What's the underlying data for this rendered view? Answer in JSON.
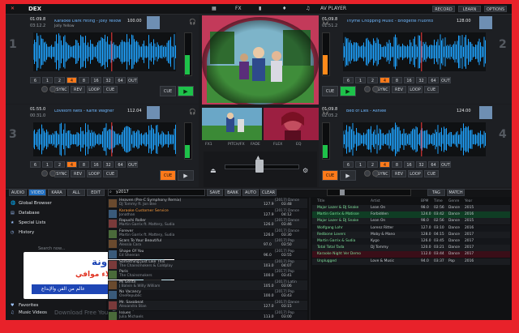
{
  "app": {
    "logo": "DEX",
    "colors": {
      "accent": "#1fa3ff",
      "green": "#22c14a",
      "orange": "#ff7a1a",
      "red": "#e8222a",
      "frame": "#e8222a"
    }
  },
  "topbar": {
    "left_items": [
      "▦",
      "FX",
      "▮",
      "♦",
      "♫"
    ],
    "right_items": [
      "RECORD",
      "LEARN",
      "OPTIONS"
    ],
    "right_title": "AV PLAYER"
  },
  "decks": [
    {
      "num": "1",
      "time": "01:09.8",
      "remain": "03:12.2",
      "title": "Karaoke Dark Hiting - Jolly Yellow",
      "sub": "Jolly Yellow",
      "bpm": "100.00",
      "side": "left",
      "color": "#1fa3ff",
      "pitch_row": [
        "6",
        "1",
        "2",
        "4",
        "8",
        "16",
        "32",
        "64",
        "OUT"
      ],
      "loop_row": [
        "SYNC",
        "REV",
        "LOOP",
        "CUE"
      ],
      "play": "▶",
      "cue": "CUE"
    },
    {
      "num": "2",
      "time": "01:09.8",
      "remain": "01:51.2",
      "title": "Thyme Chopping Music - Bridgette Fluorito",
      "sub": "",
      "bpm": "128.00",
      "side": "right",
      "color": "#1fa3ff",
      "pitch_row": [
        "6",
        "1",
        "2",
        "4",
        "8",
        "16",
        "32",
        "64",
        "OUT"
      ],
      "loop_row": [
        "SYNC",
        "REV",
        "LOOP",
        "CUE"
      ],
      "play": "▶",
      "cue": "CUE"
    },
    {
      "num": "3",
      "time": "01:55.0",
      "remain": "00:31.0",
      "title": "Lovelorn Nets - Karte Wagner",
      "sub": "",
      "bpm": "112.04",
      "side": "left",
      "color": "#1fa3ff",
      "pitch_row": [
        "6",
        "1",
        "2",
        "4",
        "8",
        "16",
        "32",
        "64",
        "OUT"
      ],
      "loop_row": [
        "SYNC",
        "REV",
        "LOOP",
        "CUE"
      ],
      "play": "▶",
      "cue": "CUE"
    },
    {
      "num": "4",
      "time": "01:09.8",
      "remain": "02:05.2",
      "title": "Bed of Lies - Ashlee",
      "sub": "",
      "bpm": "124.00",
      "side": "right",
      "color": "#1fa3ff",
      "pitch_row": [
        "6",
        "1",
        "2",
        "4",
        "8",
        "16",
        "32",
        "64",
        "OUT"
      ],
      "loop_row": [
        "SYNC",
        "REV",
        "LOOP",
        "CUE"
      ],
      "play": "▶",
      "cue": "CUE"
    }
  ],
  "mixer": {
    "labels": [
      "FX1",
      "PITCH/FX",
      "FADE",
      "FLEX",
      "EQ"
    ],
    "buttons": [
      "SAVE",
      "BANK",
      "AUTO",
      "CLEAR"
    ]
  },
  "browser": {
    "tabs": [
      "AUDIO",
      "VIDEO",
      "KARA",
      "ALL",
      "EDIT"
    ],
    "search_value": "y2017",
    "nav": [
      "Global Browser",
      "Database",
      "Special Lists",
      "History",
      "Favorites",
      "Music Videos"
    ],
    "search_hint": "Search now...",
    "watermark": "Download Free Your Desired",
    "tracks": [
      {
        "title": "Heaven (Pre-C Symphony Remix)",
        "artist": "DJ Tommy ft. Jon Bee",
        "meta": "[2017] Dance",
        "bpm": "127.9",
        "dur": "03:48"
      },
      {
        "title": "Karaoke Customer Service",
        "artist": "Jonathan",
        "meta": "[2017] Dance",
        "bpm": "127.9",
        "dur": "04:12"
      },
      {
        "title": "Rapuchi Roller",
        "artist": "Martin Garrix ft. Mattery, Sudia",
        "meta": "[2017] Dance",
        "bpm": "126.0",
        "dur": "03:46"
      },
      {
        "title": "Forever",
        "artist": "Martin Garrix ft. Mattery, Sudia",
        "meta": "[2017] Dance",
        "bpm": "126.0",
        "dur": "03:30"
      },
      {
        "title": "Scars To Your Beautiful",
        "artist": "Alessia Cara",
        "meta": "[2017] Pop",
        "bpm": "97.0",
        "dur": "03:50"
      },
      {
        "title": "Shape Of You",
        "artist": "Ed Sheeran",
        "meta": "[2017] Pop",
        "bpm": "96.0",
        "dur": "03:55"
      },
      {
        "title": "Something Just Like This",
        "artist": "The Chainsmokers & Coldplay",
        "meta": "[2017] Pop",
        "bpm": "103.0",
        "dur": "04:07"
      },
      {
        "title": "Paris",
        "artist": "The Chainsmokers",
        "meta": "[2017] Pop",
        "bpm": "100.0",
        "dur": "03:41"
      },
      {
        "title": "Mi Gente",
        "artist": "J Balvin & Willy William",
        "meta": "[2017] Latin",
        "bpm": "105.0",
        "dur": "03:06"
      },
      {
        "title": "No Vacancy",
        "artist": "OneRepublic",
        "meta": "[2017] Pop",
        "bpm": "100.0",
        "dur": "03:43"
      },
      {
        "title": "Mr. Saxobeat",
        "artist": "Alexandra Stan",
        "meta": "[2017] Dance",
        "bpm": "127.0",
        "dur": "03:15"
      },
      {
        "title": "Issues",
        "artist": "Julia Michaels",
        "meta": "[2017] Pop",
        "bpm": "113.0",
        "dur": "03:00"
      }
    ],
    "right_headers": [
      "Title",
      "Artist",
      "BPM",
      "Time",
      "Genre",
      "Year"
    ],
    "right_rows": [
      [
        "Major Lazer & DJ Snake",
        "Lean On",
        "98.0",
        "02:56",
        "Dance",
        "2015"
      ],
      [
        "Martin Garrix & Matisse",
        "Forbidden",
        "124.0",
        "03:42",
        "Dance",
        "2016"
      ],
      [
        "Major Lazer & DJ Snake",
        "Lean On",
        "98.0",
        "02:56",
        "Dance",
        "2015"
      ],
      [
        "Wolfgang Lohr",
        "Lorenz Ritter",
        "127.0",
        "03:10",
        "Dance",
        "2016"
      ],
      [
        "Redbone Lovers",
        "Moby & Mano",
        "128.0",
        "04:15",
        "Dance",
        "2017"
      ],
      [
        "Martin Garrix & Sudia",
        "Kygo",
        "126.0",
        "03:45",
        "Dance",
        "2017"
      ],
      [
        "Total Total Tada",
        "DJ Tommy",
        "120.0",
        "03:21",
        "Dance",
        "2017"
      ],
      [
        "Karaoke Night Ver Demo",
        "",
        "112.0",
        "03:44",
        "Dance",
        "2017"
      ],
      [
        "Unplugged",
        "Love & Music",
        "94.0",
        "03:37",
        "Pop",
        "2016"
      ]
    ],
    "sidebar_buttons": [
      "TAG",
      "MATCH"
    ]
  },
  "overlay": {
    "brand": "مدونة",
    "name": "الاستاذ علاء موافي",
    "tagline": "عالم من الفن والإبداع"
  }
}
